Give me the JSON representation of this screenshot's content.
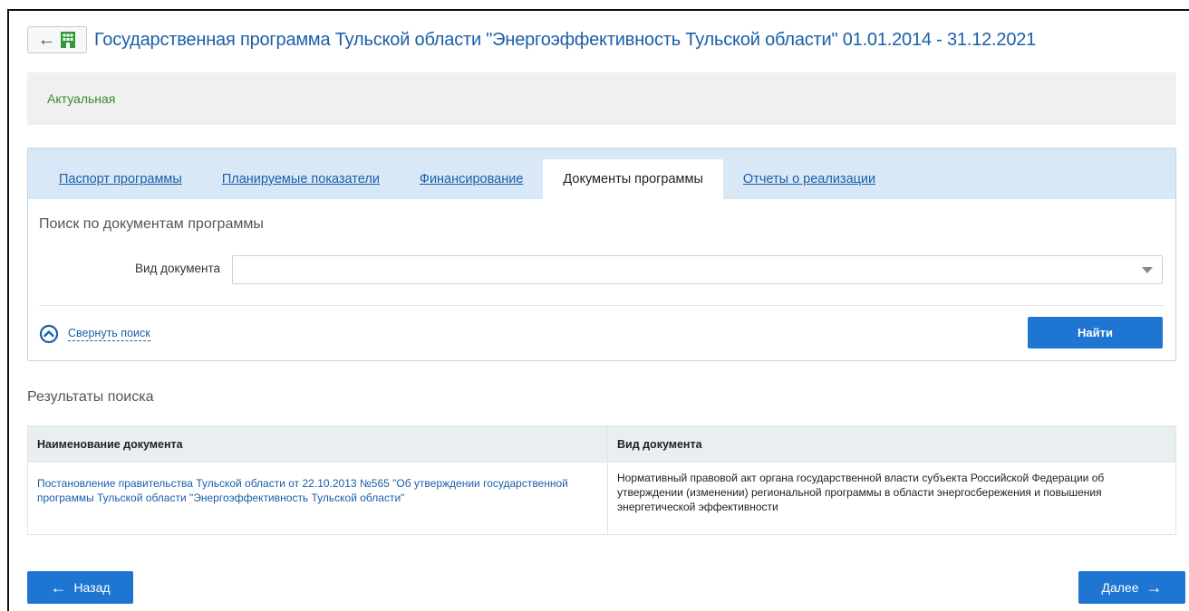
{
  "header": {
    "back_icon": "arrow-left-icon",
    "home_icon": "building-icon",
    "title": "Государственная программа Тульской области \"Энергоэффективность Тульской области\" 01.01.2014 - 31.12.2021"
  },
  "status": {
    "label": "Актуальная",
    "color": "#3a8a2e"
  },
  "tabs": [
    {
      "label": "Паспорт программы",
      "active": false
    },
    {
      "label": "Планируемые показатели",
      "active": false
    },
    {
      "label": "Финансирование",
      "active": false
    },
    {
      "label": "Документы программы",
      "active": true
    },
    {
      "label": "Отчеты о реализации",
      "active": false
    }
  ],
  "search": {
    "title": "Поиск по документам программы",
    "doc_type_label": "Вид документа",
    "doc_type_value": "",
    "collapse_label": "Свернуть поиск",
    "find_label": "Найти"
  },
  "results": {
    "title": "Результаты поиска",
    "columns": [
      "Наименование документа",
      "Вид документа"
    ],
    "rows": [
      {
        "name": "Постановление правительства Тульской области от 22.10.2013 №565 \"Об утверждении государственной программы Тульской области \"Энергоэффективность Тульской области\"",
        "type": "Нормативный правовой акт органа государственной власти субъекта Российской Федерации об утверждении (изменении) региональной программы в области энергосбережения и повышения энергетической эффективности"
      }
    ]
  },
  "nav": {
    "back_label": "Назад",
    "next_label": "Далее"
  },
  "colors": {
    "accent": "#1f76d2",
    "link": "#1a5fa8",
    "tab_bar": "#d9e8f6"
  }
}
